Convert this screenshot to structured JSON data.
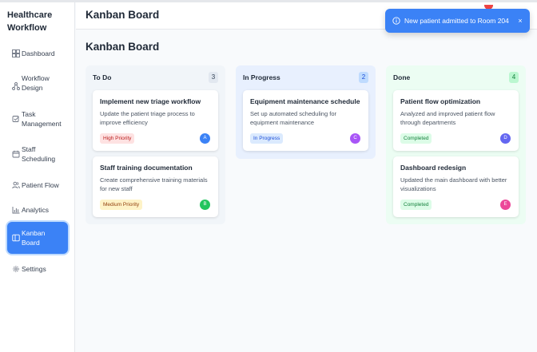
{
  "app": {
    "brand_line1": "Healthcare",
    "brand_line2": "Workflow"
  },
  "sidebar": {
    "items": [
      {
        "label_lines": [
          "Dashboard"
        ],
        "icon": "dashboard-grid-icon",
        "active": false
      },
      {
        "label_lines": [
          "Workflow",
          "Design"
        ],
        "icon": "workflow-nodes-icon",
        "active": false
      },
      {
        "label_lines": [
          "Task",
          "Management"
        ],
        "icon": "checkbox-icon",
        "active": false
      },
      {
        "label_lines": [
          "Staff",
          "Scheduling"
        ],
        "icon": "calendar-icon",
        "active": false
      },
      {
        "label_lines": [
          "Patient Flow"
        ],
        "icon": "users-icon",
        "active": false
      },
      {
        "label_lines": [
          "Analytics"
        ],
        "icon": "bar-chart-icon",
        "active": false
      },
      {
        "label_lines": [
          "Kanban",
          "Board"
        ],
        "icon": "columns-icon",
        "active": true
      },
      {
        "label_lines": [
          "Settings"
        ],
        "icon": "gear-icon",
        "active": false
      }
    ]
  },
  "header": {
    "title": "Kanban Board"
  },
  "toast": {
    "message": "New patient admitted to Room 204",
    "icon": "info-circle-icon",
    "close": "×"
  },
  "page": {
    "title": "Kanban Board"
  },
  "board": {
    "columns": [
      {
        "title": "To Do",
        "count": "3",
        "background": "#f1f5f9",
        "count_bg": "#e2e8f0",
        "count_color": "#334155",
        "cards": [
          {
            "title": "Implement new triage workflow",
            "desc": "Update the patient triage process to improve efficiency",
            "badge": "High Priority",
            "badge_bg": "#fee2e2",
            "badge_color": "#b91c1c",
            "avatar": "A",
            "avatar_color": "#3b82f6"
          },
          {
            "title": "Staff training documentation",
            "desc": "Create comprehensive training materials for new staff",
            "badge": "Medium Priority",
            "badge_bg": "#fef3c7",
            "badge_color": "#92400e",
            "avatar": "B",
            "avatar_color": "#22c55e"
          }
        ]
      },
      {
        "title": "In Progress",
        "count": "2",
        "background": "#e8f0fe",
        "count_bg": "#bfdbfe",
        "count_color": "#1d4ed8",
        "cards": [
          {
            "title": "Equipment maintenance schedule",
            "desc": "Set up automated scheduling for equipment maintenance",
            "badge": "In Progress",
            "badge_bg": "#dbeafe",
            "badge_color": "#1d4ed8",
            "avatar": "C",
            "avatar_color": "#a855f7"
          }
        ]
      },
      {
        "title": "Done",
        "count": "4",
        "background": "#ecfdf3",
        "count_bg": "#bbf7d0",
        "count_color": "#15803d",
        "cards": [
          {
            "title": "Patient flow optimization",
            "desc": "Analyzed and improved patient flow through departments",
            "badge": "Completed",
            "badge_bg": "#dcfce7",
            "badge_color": "#15803d",
            "avatar": "D",
            "avatar_color": "#6366f1"
          },
          {
            "title": "Dashboard redesign",
            "desc": "Updated the main dashboard with better visualizations",
            "badge": "Completed",
            "badge_bg": "#dcfce7",
            "badge_color": "#15803d",
            "avatar": "E",
            "avatar_color": "#ec4899"
          }
        ]
      }
    ]
  }
}
